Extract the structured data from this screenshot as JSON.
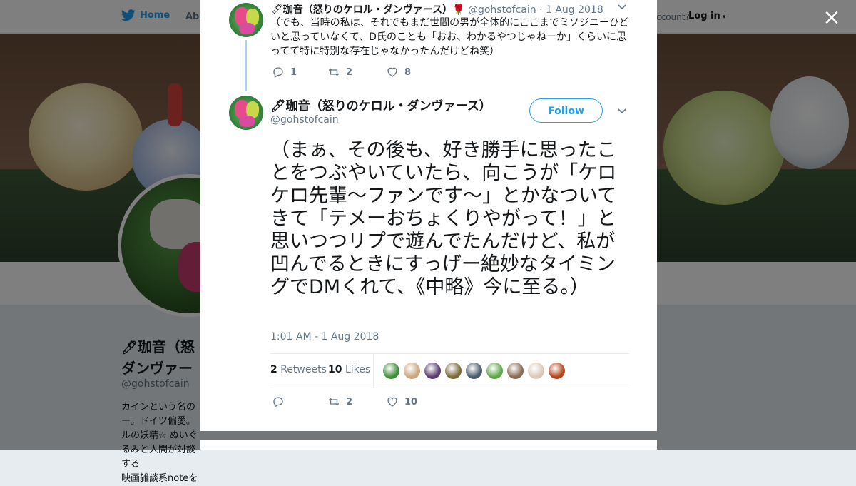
{
  "topnav": {
    "home_label": "Home",
    "about_label": "Abo",
    "account_prompt": "ccount?",
    "login_label": "Log in"
  },
  "profile": {
    "name_fragment": "珈音（怒\nダンヴァー",
    "handle": "@gohstofcain",
    "bio_fragment": "カインという名の\nー。ドイツ偏愛。\nルの妖精☆ ぬいぐるみと人間が対談する\n映画雑談系noteを"
  },
  "modal": {
    "close_label": "×",
    "parent_tweet": {
      "name": "珈音（怒りのケロル・ダンヴァース）",
      "emoji": "🌹",
      "handle": "@gohstofcain",
      "date": "· 1 Aug 2018",
      "text": "（でも、当時の私は、それでもまだ世間の男が全体的にここまでミソジニーひどいと思っていなくて、D氏のことも「おお、わかるやつじゃねーか」くらいに思ってて特に特別な存在じゃなかったんだけどね笑）",
      "replies": "1",
      "retweets": "2",
      "likes": "8"
    },
    "main_tweet": {
      "name": "珈音（怒りのケロル・ダンヴァース）",
      "handle": "@gohstofcain",
      "follow_label": "Follow",
      "text": "（まぁ、その後も、好き勝手に思ったことをつぶやいていたら、向こうが「ケロケロ先輩〜ファンです〜」とかなついてきて「テメーおちょくりやがって！」と思いつつリプで遊んでたんだけど、私が凹んでるときにすっげー絶妙なタイミングでDMくれて、《中略》今に至る。）",
      "timestamp": "1:01 AM - 1 Aug 2018",
      "retweet_count": "2",
      "retweet_label": "Retweets",
      "like_count": "10",
      "like_label": "Likes",
      "replies": "",
      "retweets": "2",
      "likes": "10"
    },
    "liker_colors": [
      "#3f8f3a",
      "#c9a77c",
      "#5a3d6e",
      "#7a6a3c",
      "#4a5b6a",
      "#5fa84a",
      "#8a6a55",
      "#d9c8b8",
      "#b5441c"
    ]
  }
}
